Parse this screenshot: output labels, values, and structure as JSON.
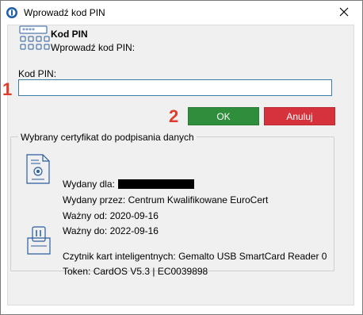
{
  "window": {
    "title": "Wprowadź kod PIN"
  },
  "header": {
    "title": "Kod PIN",
    "subtitle": "Wprowadź kod PIN:"
  },
  "pin": {
    "label": "Kod PIN:",
    "value": "",
    "placeholder": ""
  },
  "markers": {
    "one": "1",
    "two": "2"
  },
  "buttons": {
    "ok": "OK",
    "cancel": "Anuluj"
  },
  "colors": {
    "ok": "#2f8e3b",
    "cancel": "#d6323b",
    "marker": "#e03b2f",
    "input_border": "#3a7ca5"
  },
  "certificate": {
    "legend": "Wybrany certyfikat do podpisania danych",
    "issued_to_label": "Wydany dla:",
    "issued_by": "Wydany przez: Centrum Kwalifikowane EuroCert",
    "valid_from": "Ważny od: 2020-09-16",
    "valid_to": "Ważny do: 2022-09-16",
    "reader": "Czytnik kart inteligentnych: Gemalto USB SmartCard Reader 0",
    "token": "Token: CardOS V5.3 | EC0039898"
  }
}
